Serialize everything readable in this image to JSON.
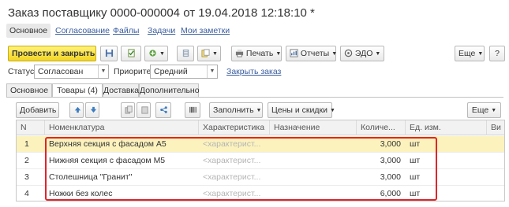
{
  "window": {
    "title": "Заказ поставщику 0000-000004 от 19.04.2018 12:18:10 *"
  },
  "nav": {
    "tabs": [
      "Основное",
      "Согласование",
      "Файлы",
      "Задачи",
      "Мои заметки"
    ]
  },
  "toolbar": {
    "post_close": "Провести и закрыть",
    "print": "Печать",
    "reports": "Отчеты",
    "edo": "ЭДО",
    "more": "Еще",
    "help": "?"
  },
  "fields": {
    "status_label": "Статус:",
    "status_value": "Согласован",
    "priority_label": "Приоритет:",
    "priority_value": "Средний",
    "close_order_link": "Закрыть заказ"
  },
  "form_tabs": [
    "Основное",
    "Товары (4)",
    "Доставка",
    "Дополнительно"
  ],
  "table_toolbar": {
    "add": "Добавить",
    "fill": "Заполнить",
    "prices": "Цены и скидки",
    "more": "Еще"
  },
  "table": {
    "columns": [
      "N",
      "Номенклатура",
      "Характеристика",
      "Назначение",
      "Количе...",
      "Ед. изм.",
      "Ви"
    ],
    "rows": [
      {
        "n": "1",
        "item": "Верхняя секция с фасадом А5",
        "characteristic": "<характерист...",
        "purpose": "",
        "qty": "3,000",
        "unit": "шт"
      },
      {
        "n": "2",
        "item": "Нижняя секция с фасадом М5",
        "characteristic": "<характерист...",
        "purpose": "",
        "qty": "3,000",
        "unit": "шт"
      },
      {
        "n": "3",
        "item": "Столешница \"Гранит\"",
        "characteristic": "<характерист...",
        "purpose": "",
        "qty": "3,000",
        "unit": "шт"
      },
      {
        "n": "4",
        "item": "Ножки без колес",
        "characteristic": "<характерист...",
        "purpose": "",
        "qty": "6,000",
        "unit": "шт"
      }
    ],
    "selected_row": 1
  },
  "colors": {
    "accent_yellow": "#f3d523",
    "link_blue": "#3a5d9f",
    "selection_row": "#fbf2bd",
    "highlight_red": "#e0242a"
  }
}
